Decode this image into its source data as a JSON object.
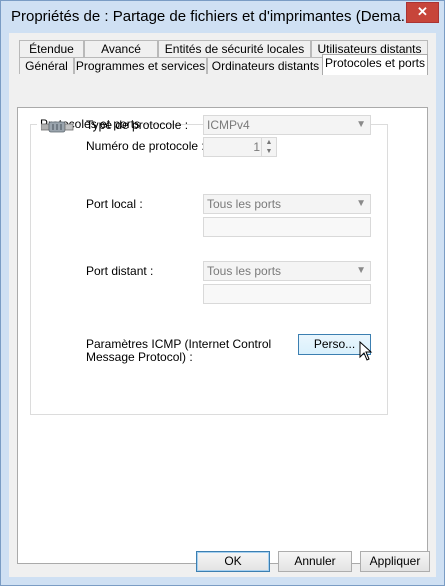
{
  "window": {
    "title": "Propriétés de : Partage de fichiers et d'imprimantes (Dema...",
    "close_symbol": "✕"
  },
  "tabs": {
    "row1": [
      "Étendue",
      "Avancé",
      "Entités de sécurité locales",
      "Utilisateurs distants"
    ],
    "row2": [
      "Général",
      "Programmes et services",
      "Ordinateurs distants",
      "Protocoles et ports"
    ]
  },
  "group": {
    "title": "Protocoles et ports"
  },
  "protocol": {
    "type_label": "Type de protocole :",
    "type_value": "ICMPv4",
    "number_label": "Numéro de protocole :",
    "number_value": "1"
  },
  "local_port": {
    "label": "Port local :",
    "value": "Tous les ports",
    "text": ""
  },
  "remote_port": {
    "label": "Port distant :",
    "value": "Tous les ports",
    "text": ""
  },
  "icmp": {
    "label_line1": "Paramètres ICMP (Internet Control",
    "label_line2": "Message Protocol) :",
    "button": "Perso..."
  },
  "footer": {
    "ok": "OK",
    "cancel": "Annuler",
    "apply": "Appliquer"
  },
  "icons": {
    "protocol": "network-plug-icon",
    "close": "close-icon",
    "cursor": "mouse-pointer-icon",
    "dropdown": "chevron-down-icon"
  }
}
